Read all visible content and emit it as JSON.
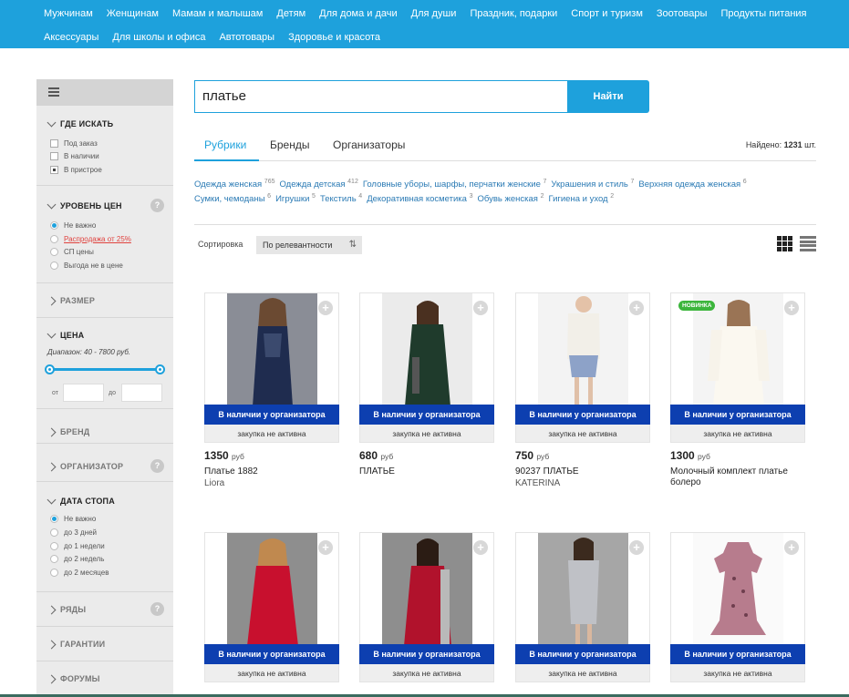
{
  "topnav": {
    "row1": [
      "Мужчинам",
      "Женщинам",
      "Мамам и малышам",
      "Детям",
      "Для дома и дачи",
      "Для души",
      "Праздник, подарки",
      "Спорт и туризм",
      "Зоотовары",
      "Продукты питания"
    ],
    "row2": [
      "Аксессуары",
      "Для школы и офиса",
      "Автотовары",
      "Здоровье и красота"
    ]
  },
  "sidebar": {
    "where": {
      "title": "Где искать",
      "options": [
        {
          "label": "Под заказ",
          "checked": false
        },
        {
          "label": "В наличии",
          "checked": false
        },
        {
          "label": "В пристрое",
          "checked": true
        }
      ]
    },
    "price_level": {
      "title": "Уровень цен",
      "help": "?",
      "options": [
        {
          "label": "Не важно",
          "checked": true
        },
        {
          "label": "Распродажа от 25%",
          "checked": false
        },
        {
          "label": "СП цены",
          "checked": false
        },
        {
          "label": "Выгода не в цене",
          "checked": false
        }
      ]
    },
    "size": {
      "title": "Размер"
    },
    "price": {
      "title": "Цена",
      "range": "Диапазон: 40 - 7800 руб.",
      "from_label": "от",
      "to_label": "до",
      "min": 40,
      "max": 7800,
      "low_fraction": 0,
      "high_fraction": 1
    },
    "brand": {
      "title": "Бренд"
    },
    "organizer": {
      "title": "Организатор",
      "help": "?"
    },
    "stop_date": {
      "title": "Дата стопа",
      "options": [
        {
          "label": "Не важно",
          "checked": true
        },
        {
          "label": "до 3 дней",
          "checked": false
        },
        {
          "label": "до 1 недели",
          "checked": false
        },
        {
          "label": "до 2 недель",
          "checked": false
        },
        {
          "label": "до 2 месяцев",
          "checked": false
        }
      ]
    },
    "rows": {
      "title": "Ряды",
      "help": "?"
    },
    "guarantees": {
      "title": "Гарантии"
    },
    "forums": {
      "title": "Форумы"
    }
  },
  "search": {
    "value": "платье",
    "button": "Найти"
  },
  "tabs": [
    {
      "label": "Рубрики",
      "active": true
    },
    {
      "label": "Бренды",
      "active": false
    },
    {
      "label": "Организаторы",
      "active": false
    }
  ],
  "found": {
    "label": "Найдено:",
    "count": "1231",
    "unit": "шт."
  },
  "rubrics": {
    "line1": [
      {
        "name": "Одежда женская",
        "count": "765"
      },
      {
        "name": "Одежда детская",
        "count": "412"
      },
      {
        "name": "Головные уборы, шарфы, перчатки женские",
        "count": "7"
      },
      {
        "name": "Украшения и стиль",
        "count": "7"
      },
      {
        "name": "Верхняя одежда женская",
        "count": "6"
      }
    ],
    "line2": [
      {
        "name": "Сумки, чемоданы",
        "count": "6"
      },
      {
        "name": "Игрушки",
        "count": "5"
      },
      {
        "name": "Текстиль",
        "count": "4"
      },
      {
        "name": "Декоративная косметика",
        "count": "3"
      },
      {
        "name": "Обувь женская",
        "count": "2"
      },
      {
        "name": "Гигиена и уход",
        "count": "2"
      }
    ]
  },
  "sort": {
    "label": "Сортировка",
    "value": "По релевантности"
  },
  "colors": {
    "accent": "#1ea1dc",
    "avail": "#0d3fb0",
    "badge": "#3cb53c",
    "sale": "#e0433f"
  },
  "products": [
    {
      "price": "1350",
      "currency": "руб",
      "name": "Платье 1882",
      "brand": "Liora",
      "avail": "В наличии у организатора",
      "status": "закупка не активна",
      "badge": "",
      "photo": "navy"
    },
    {
      "price": "680",
      "currency": "руб",
      "name": "ПЛАТЬЕ",
      "brand": "",
      "avail": "В наличии у организатора",
      "status": "закупка не активна",
      "badge": "",
      "photo": "green"
    },
    {
      "price": "750",
      "currency": "руб",
      "name": "90237 ПЛАТЬЕ",
      "brand": "KATERINA",
      "avail": "В наличии у организатора",
      "status": "закупка не активна",
      "badge": "",
      "photo": "white-blue"
    },
    {
      "price": "1300",
      "currency": "руб",
      "name": "Молочный комплект платье болеро",
      "brand": "",
      "avail": "В наличии у организатора",
      "status": "закупка не активна",
      "badge": "НОВИНКА",
      "photo": "cream"
    },
    {
      "price": "",
      "currency": "",
      "name": "",
      "brand": "",
      "avail": "В наличии у организатора",
      "status": "закупка не активна",
      "badge": "",
      "photo": "red"
    },
    {
      "price": "",
      "currency": "",
      "name": "",
      "brand": "",
      "avail": "В наличии у организатора",
      "status": "закупка не активна",
      "badge": "",
      "photo": "red-grey"
    },
    {
      "price": "",
      "currency": "",
      "name": "",
      "brand": "",
      "avail": "В наличии у организатора",
      "status": "закупка не активна",
      "badge": "",
      "photo": "grey"
    },
    {
      "price": "",
      "currency": "",
      "name": "",
      "brand": "",
      "avail": "В наличии у организатора",
      "status": "закупка не активна",
      "badge": "",
      "photo": "pink-kids"
    }
  ]
}
